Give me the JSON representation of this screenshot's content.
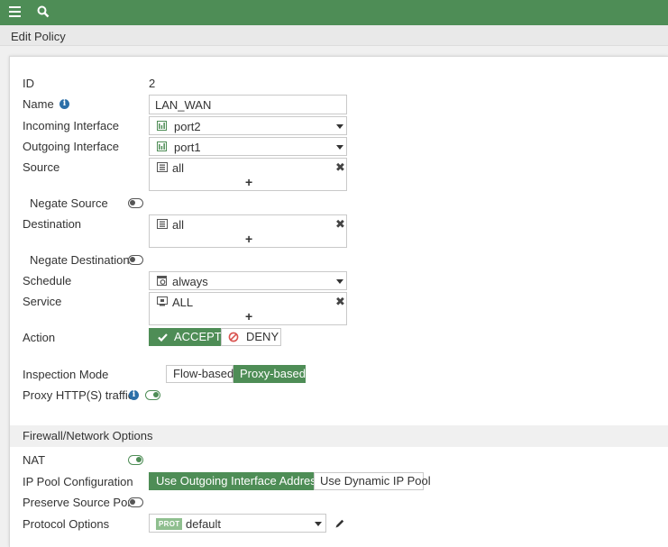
{
  "header": {
    "title": "Edit Policy",
    "icons": [
      "menu-icon",
      "search-icon"
    ]
  },
  "form": {
    "id": {
      "label": "ID",
      "value": "2"
    },
    "name": {
      "label": "Name",
      "value": "LAN_WAN"
    },
    "incoming_interface": {
      "label": "Incoming Interface",
      "value": "port2"
    },
    "outgoing_interface": {
      "label": "Outgoing Interface",
      "value": "port1"
    },
    "source": {
      "label": "Source",
      "value": "all"
    },
    "negate_source": {
      "label": "Negate Source",
      "enabled": false
    },
    "destination": {
      "label": "Destination",
      "value": "all"
    },
    "negate_destination": {
      "label": "Negate Destination",
      "enabled": false
    },
    "schedule": {
      "label": "Schedule",
      "value": "always"
    },
    "service": {
      "label": "Service",
      "value": "ALL"
    },
    "action": {
      "label": "Action",
      "options": [
        "ACCEPT",
        "DENY"
      ],
      "selected": "ACCEPT"
    },
    "inspection_mode": {
      "label": "Inspection Mode",
      "options": [
        "Flow-based",
        "Proxy-based"
      ],
      "selected": "Proxy-based"
    },
    "proxy_https": {
      "label": "Proxy HTTP(S) traffic",
      "enabled": true
    }
  },
  "firewall_options": {
    "section_title": "Firewall/Network Options",
    "nat": {
      "label": "NAT",
      "enabled": true
    },
    "ip_pool": {
      "label": "IP Pool Configuration",
      "options": [
        "Use Outgoing Interface Address",
        "Use Dynamic IP Pool"
      ],
      "selected": "Use Outgoing Interface Address"
    },
    "preserve_source_port": {
      "label": "Preserve Source Port",
      "enabled": false
    },
    "protocol_options": {
      "label": "Protocol Options",
      "badge": "PROT",
      "value": "default"
    }
  },
  "colors": {
    "brand_green": "#4e8d56",
    "info_blue": "#2b6fa8",
    "deny_red": "#d9534f"
  },
  "add_symbol": "+",
  "remove_symbol": "✖"
}
